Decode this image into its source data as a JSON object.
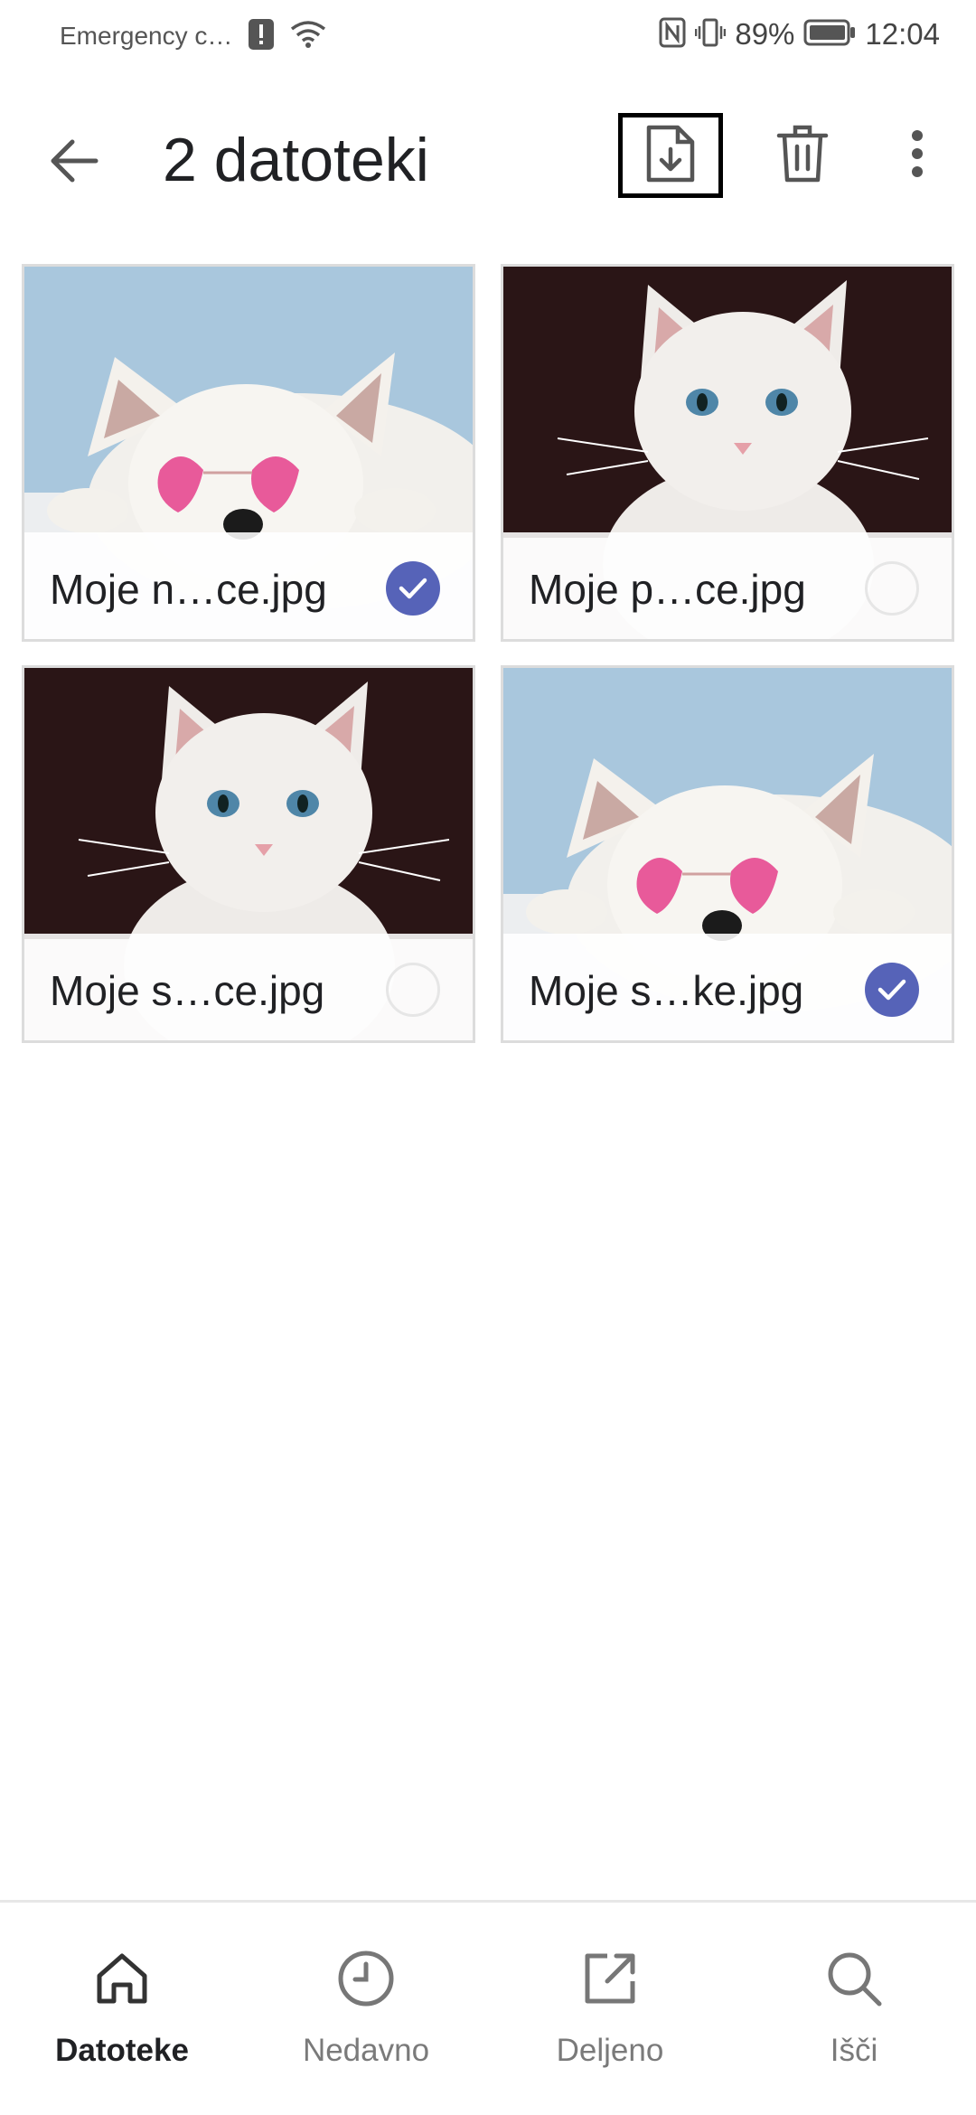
{
  "status_bar": {
    "carrier": "Emergency c…",
    "battery": "89%",
    "time": "12:04",
    "icons": [
      "alert-icon",
      "wifi-icon",
      "nfc-icon",
      "vibrate-icon",
      "battery-icon"
    ]
  },
  "app_bar": {
    "title": "2 datoteki",
    "icons": [
      "back-arrow-icon",
      "download-file-icon",
      "trash-icon",
      "more-vert-icon"
    ]
  },
  "files": [
    {
      "name": "Moje n…ce.jpg",
      "selected": true,
      "thumbnail": "dog-with-heart-glasses"
    },
    {
      "name": "Moje p…ce.jpg",
      "selected": false,
      "thumbnail": "white-kitten"
    },
    {
      "name": "Moje s…ce.jpg",
      "selected": false,
      "thumbnail": "white-kitten"
    },
    {
      "name": "Moje s…ke.jpg",
      "selected": true,
      "thumbnail": "dog-with-heart-glasses"
    }
  ],
  "bottom_nav": [
    {
      "label": "Datoteke",
      "icon": "home-icon",
      "active": true
    },
    {
      "label": "Nedavno",
      "icon": "clock-icon",
      "active": false
    },
    {
      "label": "Deljeno",
      "icon": "share-icon",
      "active": false
    },
    {
      "label": "Išči",
      "icon": "search-icon",
      "active": false
    }
  ],
  "colors": {
    "accent": "#5663b8",
    "text": "#202124",
    "muted": "#7a7a7a",
    "sky": "#a9c7dd"
  }
}
